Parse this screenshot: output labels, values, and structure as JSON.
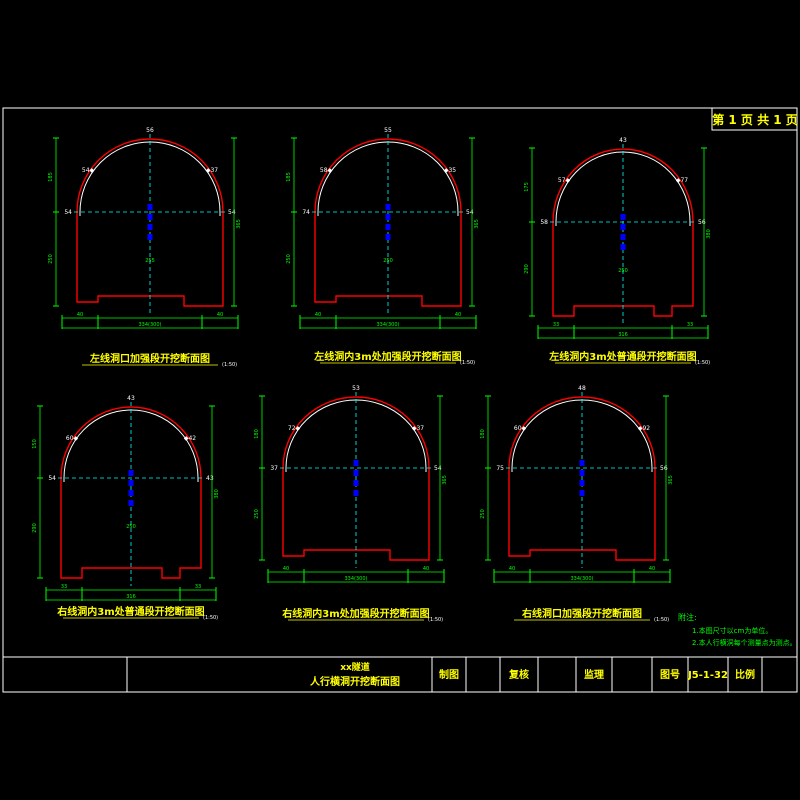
{
  "page_label": "第 1 页 共 1 页",
  "colors": {
    "background": "#000000",
    "frame": "#ffffff",
    "outline": "#ff0000",
    "arch": "#ffffff",
    "dimension": "#00ff00",
    "centerline": "#00ffff",
    "title": "#ffff00",
    "points": "#0000ff"
  },
  "sections": [
    {
      "title": "左线洞口加强段开挖断面图",
      "scale": "(1:50)",
      "top": "56",
      "left_upper": "54",
      "right_upper": "37",
      "left_mid": "54",
      "right_mid": "54",
      "left_dims": [
        "185",
        "250"
      ],
      "right_dim": "365",
      "bottom_total": "334(300)",
      "bottom_left": "40",
      "bottom_right": "40",
      "inner_width": "255"
    },
    {
      "title": "左线洞内3m处加强段开挖断面图",
      "scale": "(1:50)",
      "top": "55",
      "left_upper": "58",
      "right_upper": "35",
      "left_mid": "74",
      "right_mid": "54",
      "left_dims": [
        "185",
        "250"
      ],
      "right_dim": "365",
      "bottom_total": "334(300)",
      "bottom_left": "40",
      "bottom_right": "40",
      "inner_width": "250"
    },
    {
      "title": "左线洞内3m处普通段开挖断面图",
      "scale": "(1:50)",
      "top": "43",
      "left_upper": "57",
      "right_upper": "77",
      "left_mid": "58",
      "right_mid": "56",
      "left_dims": [
        "175",
        "290"
      ],
      "right_dim": "380",
      "bottom_total": "316",
      "bottom_left": "33",
      "bottom_right": "33",
      "inner_width": "250"
    },
    {
      "title": "右线洞内3m处普通段开挖断面图",
      "scale": "(1:50)",
      "top": "43",
      "left_upper": "60",
      "right_upper": "42",
      "left_mid": "54",
      "right_mid": "43",
      "left_dims": [
        "150",
        "290"
      ],
      "right_dim": "380",
      "bottom_total": "316",
      "bottom_left": "33",
      "bottom_right": "33",
      "inner_width": "250"
    },
    {
      "title": "右线洞内3m处加强段开挖断面图",
      "scale": "(1:50)",
      "top": "53",
      "left_upper": "72",
      "right_upper": "37",
      "left_mid": "37",
      "right_mid": "54",
      "left_dims": [
        "180",
        "250"
      ],
      "right_dim": "365",
      "bottom_total": "334(300)",
      "bottom_left": "40",
      "bottom_right": "40",
      "inner_width": ""
    },
    {
      "title": "右线洞口加强段开挖断面图",
      "scale": "(1:50)",
      "top": "48",
      "left_upper": "60",
      "right_upper": "92",
      "left_mid": "75",
      "right_mid": "56",
      "left_dims": [
        "180",
        "250"
      ],
      "right_dim": "365",
      "bottom_total": "334(300)",
      "bottom_left": "40",
      "bottom_right": "40",
      "inner_width": ""
    }
  ],
  "notes": {
    "heading": "附注:",
    "lines": [
      "1.本图尺寸以cm为单位。",
      "2.本人行横洞每个测量点为测点。"
    ]
  },
  "title_block": {
    "project": "xx隧道",
    "drawing_name": "人行横洞开挖断面图",
    "design_label": "制图",
    "review_label": "复核",
    "supervise_label": "监理",
    "number_label": "图号",
    "number_value": "J5-1-32",
    "scale_label": "比例"
  }
}
